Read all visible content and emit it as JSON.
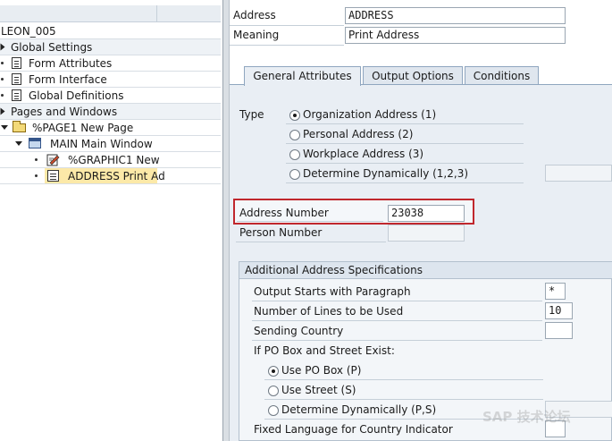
{
  "tree": {
    "items": [
      {
        "label": "LEON_005"
      },
      {
        "label": "Global Settings"
      },
      {
        "label": "Form Attributes"
      },
      {
        "label": "Form Interface"
      },
      {
        "label": "Global Definitions"
      },
      {
        "label": "Pages and Windows"
      },
      {
        "label": "%PAGE1 New Page"
      },
      {
        "label": "MAIN Main Window"
      },
      {
        "label": "%GRAPHIC1 New"
      },
      {
        "label": "ADDRESS Print Ad"
      }
    ]
  },
  "header": {
    "address_label": "Address",
    "address_value": "ADDRESS",
    "meaning_label": "Meaning",
    "meaning_value": "Print Address"
  },
  "tabs": [
    {
      "label": "General Attributes",
      "active": true
    },
    {
      "label": "Output Options",
      "active": false
    },
    {
      "label": "Conditions",
      "active": false
    }
  ],
  "type_section": {
    "label": "Type",
    "options": [
      {
        "label": "Organization Address (1)",
        "selected": true
      },
      {
        "label": "Personal Address (2)",
        "selected": false
      },
      {
        "label": "Workplace Address (3)",
        "selected": false
      },
      {
        "label": "Determine Dynamically (1,2,3)",
        "selected": false
      }
    ]
  },
  "address_number": {
    "label": "Address Number",
    "value": "23038"
  },
  "person_number": {
    "label": "Person Number",
    "value": ""
  },
  "additional": {
    "title": "Additional Address Specifications",
    "output_paragraph": {
      "label": "Output Starts with Paragraph",
      "value": "*"
    },
    "num_lines": {
      "label": "Number of Lines to be Used",
      "value": "10"
    },
    "sending_country": {
      "label": "Sending Country",
      "value": ""
    },
    "po_box_label": "If PO Box and Street Exist:",
    "po_options": [
      {
        "label": "Use PO Box (P)",
        "selected": true
      },
      {
        "label": "Use Street (S)",
        "selected": false
      },
      {
        "label": "Determine Dynamically (P,S)",
        "selected": false
      }
    ],
    "fixed_language": {
      "label": "Fixed Language for Country Indicator",
      "value": ""
    }
  },
  "watermark": "SAP 技术论坛",
  "colors": {
    "highlight_border": "#c0272d",
    "selection": "#fce9a8",
    "tab_bg": "#e9eef4"
  }
}
